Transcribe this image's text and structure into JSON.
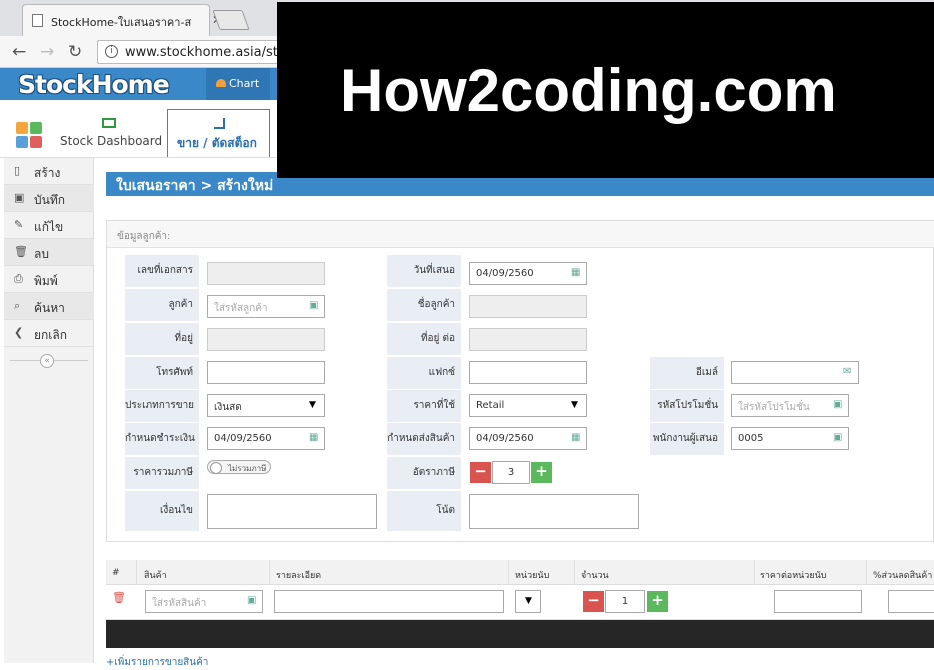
{
  "browser": {
    "tab_title": "StockHome-ใบเสนอราคา-สร้",
    "url": "www.stockhome.asia/sto"
  },
  "app": {
    "logo": "StockHome",
    "chart_label": "Chart",
    "nav": {
      "dashboard": "Stock Dashboard",
      "sale": "ขาย / ตัดสต็อก"
    }
  },
  "watermark": "How2coding.com",
  "sidebar": {
    "items": [
      {
        "label": "สร้าง",
        "icon": "file-icon"
      },
      {
        "label": "บันทึก",
        "icon": "save-icon"
      },
      {
        "label": "แก้ไข",
        "icon": "edit-icon"
      },
      {
        "label": "ลบ",
        "icon": "trash-icon"
      },
      {
        "label": "พิมพ์",
        "icon": "print-icon"
      },
      {
        "label": "ค้นหา",
        "icon": "search-icon"
      },
      {
        "label": "ยกเลิก",
        "icon": "back-icon"
      }
    ],
    "collapse": "«"
  },
  "page": {
    "title": "ใบเสนอราคา > สร้างใหม่"
  },
  "customer": {
    "section_title": "ข้อมูลลูกค้า:",
    "fields": {
      "doc_no_label": "เลขที่เอกสาร",
      "offer_date_label": "วันที่เสนอ",
      "offer_date_value": "04/09/2560",
      "customer_label": "ลูกค้า",
      "customer_placeholder": "ใส่รหัสลูกค้า",
      "customer_name_label": "ชื่อลูกค้า",
      "address_label": "ที่อยู่",
      "address2_label": "ที่อยู่ ต่อ",
      "phone_label": "โทรศัพท์",
      "fax_label": "แฟกซ์",
      "email_label": "อีเมล์",
      "sale_type_label": "ประเภทการขาย",
      "sale_type_value": "เงินสด",
      "price_label": "ราคาที่ใช้",
      "price_value": "Retail",
      "promo_label": "รหัสโปรโมชั่น",
      "promo_placeholder": "ใส่รหัสโปรโมชั่น",
      "due_date_label": "กำหนดชำระเงิน",
      "due_date_value": "04/09/2560",
      "delivery_label": "กำหนดส่งสินค้า",
      "delivery_value": "04/09/2560",
      "staff_label": "พนักงานผู้เสนอ",
      "staff_value": "0005",
      "vat_label": "ราคารวมภาษี",
      "vat_toggle": "ไม่รวมภาษี",
      "tax_rate_label": "อัตราภาษี",
      "tax_rate_value": "3",
      "condition_label": "เงื่อนไข",
      "note_label": "โน้ต"
    }
  },
  "products": {
    "headers": [
      "#",
      "สินค้า",
      "รายละเอียด",
      "หน่วยนับ",
      "จำนวน",
      "ราคาต่อหน่วยนับ",
      "%ส่วนลดสินค้า"
    ],
    "product_placeholder": "ใส่รหัสสินค้า",
    "qty_value": "1",
    "add_line": "+เพิ่มรายการขายสินค้า"
  },
  "colors": {
    "primary": "#3a88c8",
    "danger": "#d9534f",
    "success": "#5cb85c"
  }
}
